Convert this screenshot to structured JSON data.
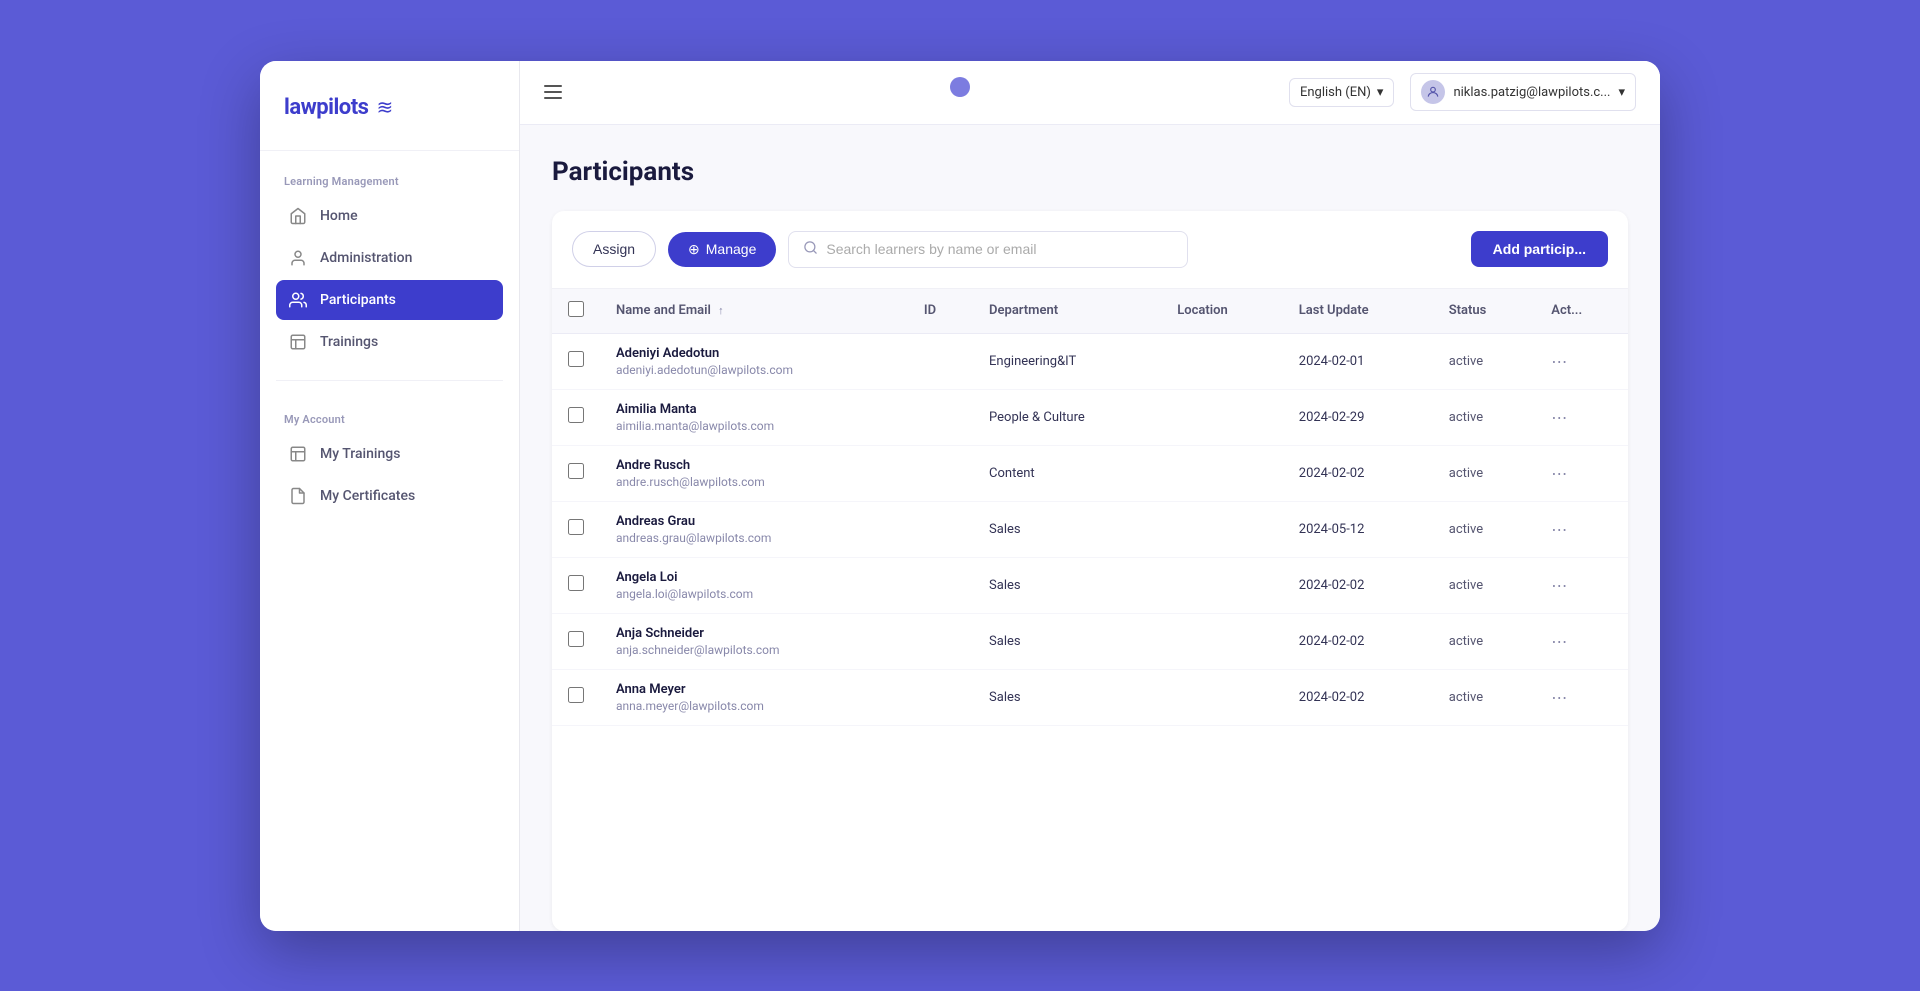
{
  "app": {
    "logo_text": "lawpilots",
    "logo_wave": "≋"
  },
  "header": {
    "hamburger_label": "menu",
    "language": "English (EN)",
    "user_email": "niklas.patzig@lawpilots.c...",
    "chevron": "▾"
  },
  "sidebar": {
    "learning_management": {
      "section_label": "Learning Management",
      "items": [
        {
          "id": "home",
          "label": "Home",
          "icon": "⌂",
          "active": false
        },
        {
          "id": "administration",
          "label": "Administration",
          "icon": "👤",
          "active": false
        },
        {
          "id": "participants",
          "label": "Participants",
          "icon": "👥",
          "active": true
        },
        {
          "id": "trainings",
          "label": "Trainings",
          "icon": "📋",
          "active": false
        }
      ]
    },
    "my_account": {
      "section_label": "My Account",
      "items": [
        {
          "id": "my-trainings",
          "label": "My Trainings",
          "icon": "📋",
          "active": false
        },
        {
          "id": "my-certificates",
          "label": "My Certificates",
          "icon": "📄",
          "active": false
        }
      ]
    }
  },
  "page": {
    "title": "Participants"
  },
  "toolbar": {
    "assign_label": "Assign",
    "manage_label": "Manage",
    "manage_icon": "⊕",
    "search_placeholder": "Search learners by name or email",
    "add_participant_label": "Add particip..."
  },
  "table": {
    "columns": [
      {
        "id": "checkbox",
        "label": ""
      },
      {
        "id": "name_email",
        "label": "Name and Email",
        "sort": "↑"
      },
      {
        "id": "id",
        "label": "ID"
      },
      {
        "id": "department",
        "label": "Department"
      },
      {
        "id": "location",
        "label": "Location"
      },
      {
        "id": "last_update",
        "label": "Last Update"
      },
      {
        "id": "status",
        "label": "Status"
      },
      {
        "id": "actions",
        "label": "Act..."
      }
    ],
    "rows": [
      {
        "name": "Adeniyi Adedotun",
        "email": "adeniyi.adedotun@lawpilots.com",
        "id": "",
        "department": "Engineering&IT",
        "location": "",
        "last_update": "2024-02-01",
        "status": "active"
      },
      {
        "name": "Aimilia Manta",
        "email": "aimilia.manta@lawpilots.com",
        "id": "",
        "department": "People & Culture",
        "location": "",
        "last_update": "2024-02-29",
        "status": "active"
      },
      {
        "name": "Andre Rusch",
        "email": "andre.rusch@lawpilots.com",
        "id": "",
        "department": "Content",
        "location": "",
        "last_update": "2024-02-02",
        "status": "active"
      },
      {
        "name": "Andreas Grau",
        "email": "andreas.grau@lawpilots.com",
        "id": "",
        "department": "Sales",
        "location": "",
        "last_update": "2024-05-12",
        "status": "active"
      },
      {
        "name": "Angela Loi",
        "email": "angela.loi@lawpilots.com",
        "id": "",
        "department": "Sales",
        "location": "",
        "last_update": "2024-02-02",
        "status": "active"
      },
      {
        "name": "Anja Schneider",
        "email": "anja.schneider@lawpilots.com",
        "id": "",
        "department": "Sales",
        "location": "",
        "last_update": "2024-02-02",
        "status": "active"
      },
      {
        "name": "Anna Meyer",
        "email": "anna.meyer@lawpilots.com",
        "id": "",
        "department": "Sales",
        "location": "",
        "last_update": "2024-02-02",
        "status": "active"
      }
    ]
  }
}
